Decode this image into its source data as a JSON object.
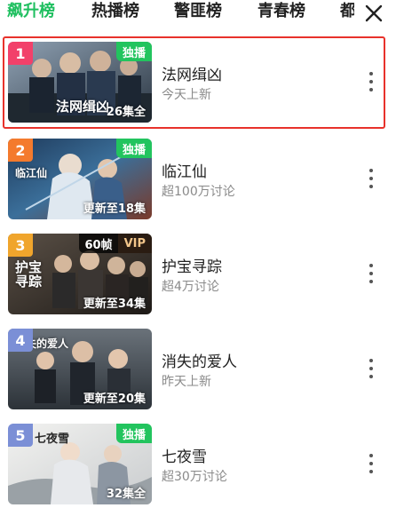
{
  "tabs": [
    {
      "label": "飙升榜",
      "active": true
    },
    {
      "label": "热播榜",
      "active": false
    },
    {
      "label": "警匪榜",
      "active": false
    },
    {
      "label": "青春榜",
      "active": false
    },
    {
      "label": "都",
      "active": false
    }
  ],
  "close_icon": "close-x-icon",
  "colors": {
    "active_tab": "#1ebf5f",
    "highlight_border": "#e8322b",
    "exclusive_badge": "#22c45e",
    "rank1": "#f2416a",
    "rank2": "#f47a2d",
    "rank3": "#f0a52c",
    "rank4": "#7b8fd6",
    "rank5": "#7b8fd6"
  },
  "items": [
    {
      "rank": "1",
      "title": "法网缉凶",
      "subtitle": "今天上新",
      "badge": "独播",
      "episodes": "26集全",
      "poster_text": "法网缉凶",
      "highlighted": true
    },
    {
      "rank": "2",
      "title": "临江仙",
      "subtitle": "超100万讨论",
      "badge": "独播",
      "episodes": "更新至18集",
      "poster_text": "临江仙"
    },
    {
      "rank": "3",
      "title": "护宝寻踪",
      "subtitle": "超4万讨论",
      "badge_fps": "60帧",
      "badge_vip": "VIP",
      "episodes": "更新至34集",
      "poster_text": "护宝寻踪"
    },
    {
      "rank": "4",
      "title": "消失的爱人",
      "subtitle": "昨天上新",
      "episodes": "更新至20集",
      "poster_text": "消失的爱人"
    },
    {
      "rank": "5",
      "title": "七夜雪",
      "subtitle": "超30万讨论",
      "badge": "独播",
      "episodes": "32集全",
      "poster_text": "七夜雪"
    }
  ]
}
